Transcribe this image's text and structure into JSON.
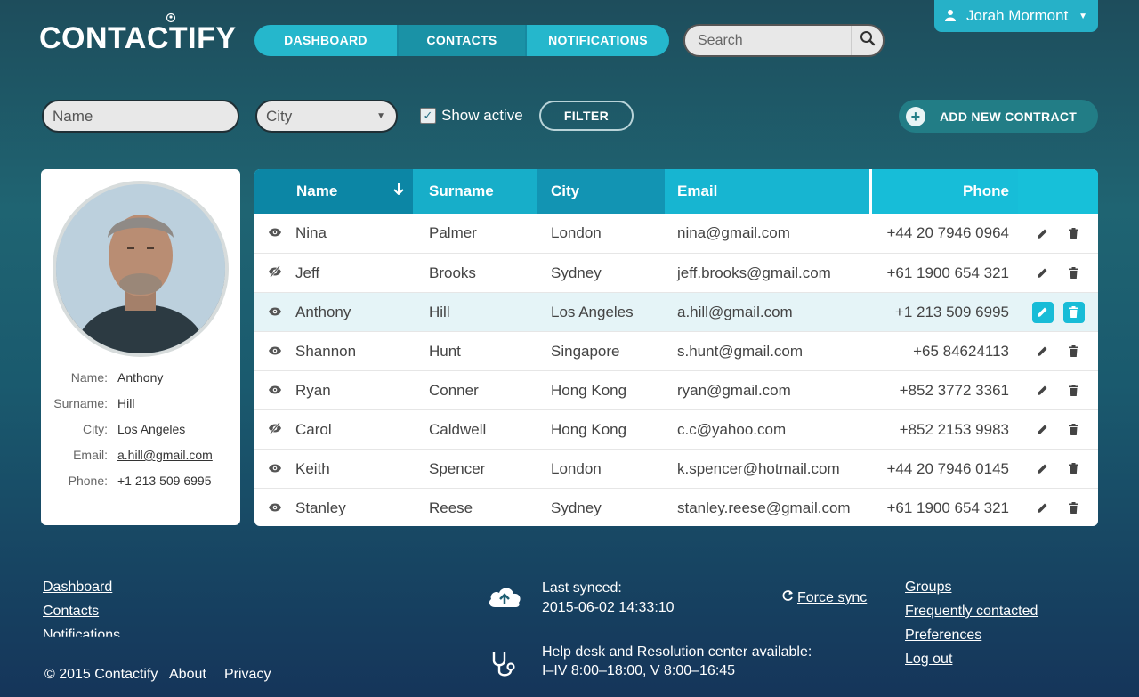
{
  "header": {
    "logo": "CONTACTIFY",
    "nav": [
      "DASHBOARD",
      "CONTACTS",
      "NOTIFICATIONS"
    ],
    "search_placeholder": "Search",
    "user_name": "Jorah Mormont"
  },
  "filters": {
    "name_placeholder": "Name",
    "city_placeholder": "City",
    "show_active_label": "Show active",
    "show_active_checked": true,
    "filter_button": "FILTER",
    "add_button": "ADD NEW CONTRACT"
  },
  "contact": {
    "labels": {
      "name": "Name:",
      "surname": "Surname:",
      "city": "City:",
      "email": "Email:",
      "phone": "Phone:"
    },
    "name": "Anthony",
    "surname": "Hill",
    "city": "Los Angeles",
    "email": "a.hill@gmail.com",
    "phone": "+1 213 509 6995"
  },
  "table": {
    "columns": [
      "Name",
      "Surname",
      "City",
      "Email",
      "Phone"
    ],
    "rows": [
      {
        "name": "Nina",
        "surname": "Palmer",
        "city": "London",
        "email": "nina@gmail.com",
        "phone": "+44 20 7946 0964",
        "active": true
      },
      {
        "name": "Jeff",
        "surname": "Brooks",
        "city": "Sydney",
        "email": "jeff.brooks@gmail.com",
        "phone": "+61 1900 654 321",
        "active": false
      },
      {
        "name": "Anthony",
        "surname": "Hill",
        "city": "Los Angeles",
        "email": "a.hill@gmail.com",
        "phone": "+1 213 509 6995",
        "active": true
      },
      {
        "name": "Shannon",
        "surname": "Hunt",
        "city": "Singapore",
        "email": "s.hunt@gmail.com",
        "phone": "+65 84624113",
        "active": true
      },
      {
        "name": "Ryan",
        "surname": "Conner",
        "city": "Hong Kong",
        "email": "ryan@gmail.com",
        "phone": "+852 3772 3361",
        "active": true
      },
      {
        "name": "Carol",
        "surname": "Caldwell",
        "city": "Hong Kong",
        "email": "c.c@yahoo.com",
        "phone": "+852 2153 9983",
        "active": false
      },
      {
        "name": "Keith",
        "surname": "Spencer",
        "city": "London",
        "email": "k.spencer@hotmail.com",
        "phone": "+44 20 7946 0145",
        "active": true
      },
      {
        "name": "Stanley",
        "surname": "Reese",
        "city": "Sydney",
        "email": "stanley.reese@gmail.com",
        "phone": "+61 1900 654 321",
        "active": true
      }
    ]
  },
  "footer": {
    "links_left": [
      "Dashboard",
      "Contacts",
      "Notifications"
    ],
    "last_synced_label": "Last synced:",
    "last_synced_value": "2015-06-02 14:33:10",
    "force_sync": "Force sync",
    "links_right": [
      "Groups",
      "Frequently contacted",
      "Preferences",
      "Log out"
    ],
    "copyright": "© 2015 Contactify",
    "about": "About",
    "privacy": "Privacy",
    "availability_line1": "Help desk and Resolution center available:",
    "availability_line2": "I–IV 8:00–18:00, V 8:00–16:45"
  },
  "colors": {
    "accent": "#17c0d9",
    "accent_dark": "#0c86a5",
    "add_button": "#227d86"
  }
}
